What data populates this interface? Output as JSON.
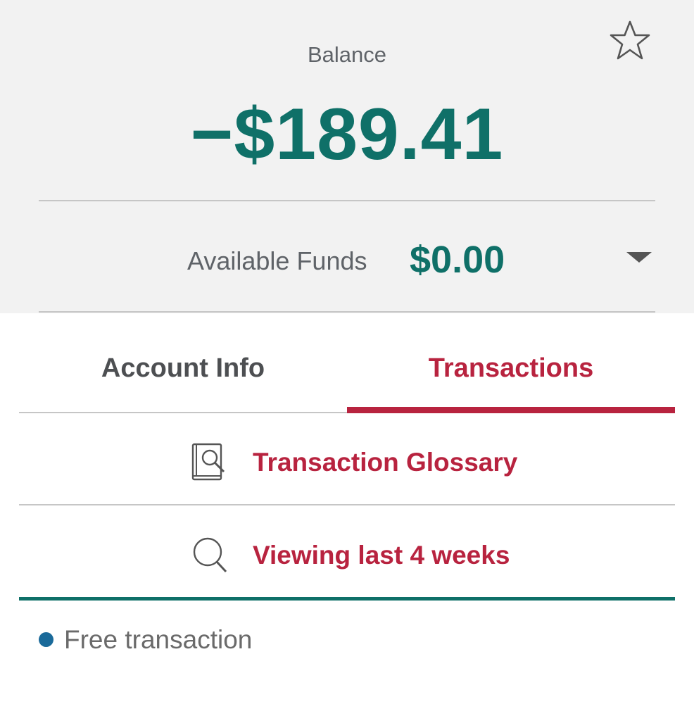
{
  "header": {
    "balance_label": "Balance",
    "balance_amount": "−$189.41",
    "available_funds_label": "Available Funds",
    "available_funds_value": "$0.00"
  },
  "tabs": [
    {
      "label": "Account Info",
      "active": false
    },
    {
      "label": "Transactions",
      "active": true
    }
  ],
  "actions": {
    "glossary_label": "Transaction Glossary",
    "viewing_label": "Viewing last 4 weeks"
  },
  "legend": {
    "free_transaction_label": "Free transaction",
    "free_transaction_color": "#1a6a9a"
  },
  "icons": [
    "star-icon",
    "dropdown-arrow-icon",
    "glossary-book-icon",
    "search-icon"
  ],
  "colors": {
    "brand_teal": "#0f7068",
    "accent_red": "#b8233f",
    "header_bg": "#f2f2f2"
  }
}
